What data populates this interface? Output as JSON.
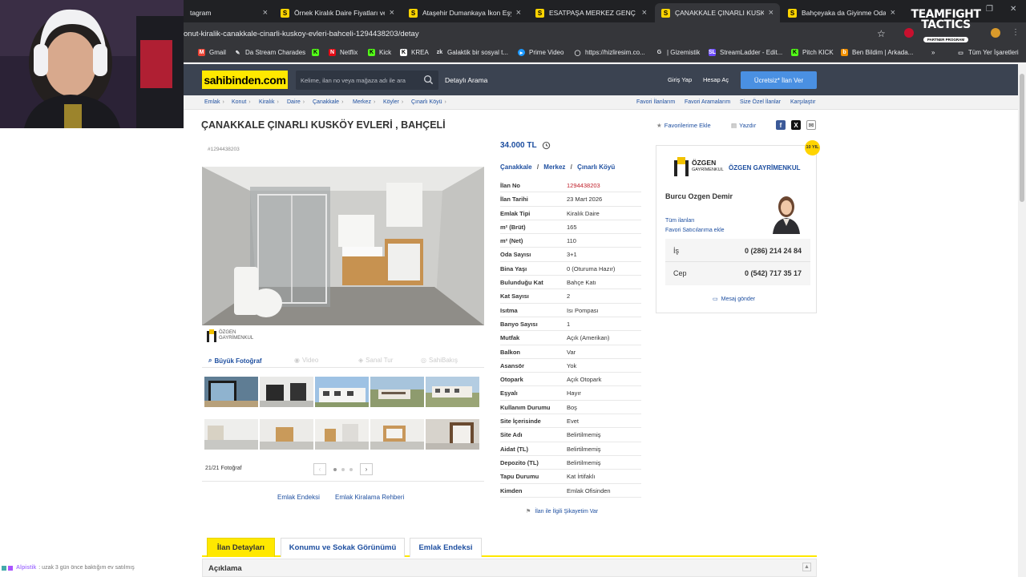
{
  "browser": {
    "tabs": [
      {
        "title": "tagram",
        "favicon": ""
      },
      {
        "title": "Örnek Kiralık Daire Fiyatları ve İ",
        "favicon": "S"
      },
      {
        "title": "Ataşehir Dumankaya İkon Eşyalı",
        "favicon": "S"
      },
      {
        "title": "ESATPAŞA MERKEZ GENÇ BİNA",
        "favicon": "S"
      },
      {
        "title": "ÇANAKKALE ÇINARLI KUSKÖY E",
        "favicon": "S"
      },
      {
        "title": "Bahçeyaka da Giyinme Odalı S",
        "favicon": "S"
      }
    ],
    "url": "onut-kiralik-canakkale-cinarli-kuskoy-evleri-bahceli-1294438203/detay",
    "bookmarks": [
      {
        "label": "Gmail",
        "icon": "gmail-icon"
      },
      {
        "label": "Da Stream Charades",
        "icon": "pin-icon"
      },
      {
        "label": "",
        "icon": "kick-icon"
      },
      {
        "label": "Netflix",
        "icon": "netflix-icon"
      },
      {
        "label": "Kick",
        "icon": "kick-icon"
      },
      {
        "label": "KREA",
        "icon": "krea-icon"
      },
      {
        "label": "Galaktik bir sosyal t...",
        "icon": "zk-icon"
      },
      {
        "label": "Prime Video",
        "icon": "prime-icon"
      },
      {
        "label": "https://hizliresim.co...",
        "icon": "globe-icon"
      },
      {
        "label": "| Gizemistik",
        "icon": "g-icon"
      },
      {
        "label": "StreamLadder - Edit...",
        "icon": "sl-icon"
      },
      {
        "label": "Pitch KICK",
        "icon": "kick-icon"
      },
      {
        "label": "Ben Bildim | Arkada...",
        "icon": "bb-icon"
      }
    ],
    "bookmarks_more": "»",
    "other_bookmarks": "Tüm Yer İşaretleri"
  },
  "header": {
    "logo": "sahibinden.com",
    "search_placeholder": "Kelime, ilan no veya mağaza adı ile ara",
    "detailed_search": "Detaylı Arama",
    "login": "Giriş Yap",
    "register": "Hesap Aç",
    "post_ad": "Ücretsiz* İlan Ver"
  },
  "breadcrumb": [
    "Emlak",
    "Konut",
    "Kiralık",
    "Daire",
    "Çanakkale",
    "Merkez",
    "Köyler",
    "Çınarlı Köyü"
  ],
  "breadcrumb_links": [
    "Favori İlanlarım",
    "Favori Aramalarım",
    "Size Özel İlanlar",
    "Karşılaştır"
  ],
  "listing": {
    "title": "ÇANAKKALE ÇINARLI KUSKÖY EVLERİ , BAHÇELİ",
    "add_favorite": "Favorilerime Ekle",
    "print": "Yazdır",
    "number_small": "#1294438203",
    "price": "34.000 TL",
    "location": [
      "Çanakkale",
      "Merkez",
      "Çınarlı Köyü"
    ],
    "details": [
      {
        "k": "İlan No",
        "v": "1294438203"
      },
      {
        "k": "İlan Tarihi",
        "v": "23 Mart 2026"
      },
      {
        "k": "Emlak Tipi",
        "v": "Kiralık Daire"
      },
      {
        "k": "m² (Brüt)",
        "v": "165"
      },
      {
        "k": "m² (Net)",
        "v": "110"
      },
      {
        "k": "Oda Sayısı",
        "v": "3+1"
      },
      {
        "k": "Bina Yaşı",
        "v": "0 (Oturuma Hazır)"
      },
      {
        "k": "Bulunduğu Kat",
        "v": "Bahçe Katı"
      },
      {
        "k": "Kat Sayısı",
        "v": "2"
      },
      {
        "k": "Isıtma",
        "v": "Isı Pompası"
      },
      {
        "k": "Banyo Sayısı",
        "v": "1"
      },
      {
        "k": "Mutfak",
        "v": "Açık (Amerikan)"
      },
      {
        "k": "Balkon",
        "v": "Var"
      },
      {
        "k": "Asansör",
        "v": "Yok"
      },
      {
        "k": "Otopark",
        "v": "Açık Otopark"
      },
      {
        "k": "Eşyalı",
        "v": "Hayır"
      },
      {
        "k": "Kullanım Durumu",
        "v": "Boş"
      },
      {
        "k": "Site İçerisinde",
        "v": "Evet"
      },
      {
        "k": "Site Adı",
        "v": "Belirtilmemiş"
      },
      {
        "k": "Aidat (TL)",
        "v": "Belirtilmemiş"
      },
      {
        "k": "Depozito (TL)",
        "v": "Belirtilmemiş"
      },
      {
        "k": "Tapu Durumu",
        "v": "Kat İrtifaklı"
      },
      {
        "k": "Kimden",
        "v": "Emlak Ofisinden"
      }
    ],
    "complaint": "İlan ile İlgili Şikayetim Var"
  },
  "gallery": {
    "agency_mini": "ÖZGEN GAYRİMENKUL",
    "big_photo": "Büyük Fotoğraf",
    "video": "Video",
    "virtual_tour": "Sanal Tur",
    "sahibinden_label": "SahiBakış",
    "photo_count": "21/21 Fotoğraf",
    "prev": "‹",
    "next": "›"
  },
  "bottom_links": {
    "index": "Emlak Endeksi",
    "guide": "Emlak Kiralama Rehberi"
  },
  "seller": {
    "badge": "10 YIL",
    "agency": "ÖZGEN GAYRİMENKUL",
    "logo_l1": "ÖZGEN",
    "logo_l2": "GAYRİMENKUL",
    "name": "Burcu Ozgen Demir",
    "all_ads": "Tüm ilanları",
    "fav_seller": "Favori Satıcılarıma ekle",
    "work_label": "İş",
    "work_phone": "0 (286) 214 24 84",
    "mobile_label": "Cep",
    "mobile_phone": "0 (542) 717 35 17",
    "send_message": "Mesaj gönder"
  },
  "detail_tabs": [
    "İlan Detayları",
    "Konumu ve Sokak Görünümü",
    "Emlak Endeksi"
  ],
  "description_label": "Açıklama",
  "overlay": {
    "chat_user": "Alpistik",
    "chat_text": ": uzak 3 gün önce baktığım ev satılmış",
    "tft_l1": "TEAMFIGHT",
    "tft_l2": "TACTICS",
    "tft_l3": "PARTNER PROGRAM"
  },
  "colors": {
    "brand_yellow": "#ffe800",
    "header": "#3b4351",
    "link": "#1e4fa0",
    "cta": "#4a90e2"
  }
}
